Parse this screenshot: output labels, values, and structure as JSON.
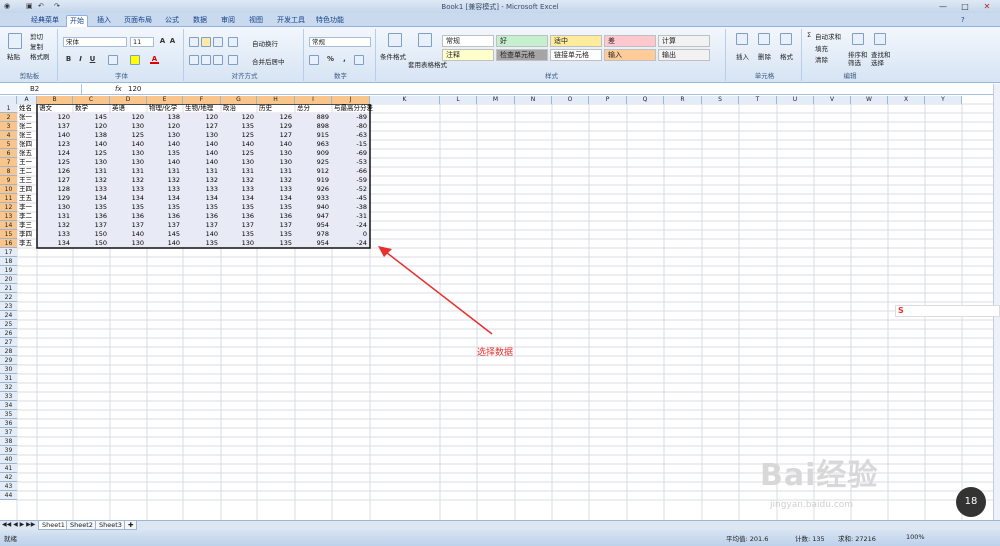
{
  "window": {
    "title": "Book1 [兼容模式] - Microsoft Excel",
    "min": "—",
    "max": "□",
    "close": "✕"
  },
  "tabs": [
    "经典菜单",
    "开始",
    "插入",
    "页面布局",
    "公式",
    "数据",
    "审阅",
    "视图",
    "开发工具",
    "特色功能"
  ],
  "ribbon": {
    "clipboard": {
      "title": "剪贴板",
      "paste": "粘贴",
      "cut": "剪切",
      "copy": "复制",
      "format_painter": "格式刷"
    },
    "font": {
      "title": "字体",
      "name": "宋体",
      "size": "11",
      "bold": "B",
      "italic": "I",
      "underline": "U"
    },
    "alignment": {
      "title": "对齐方式",
      "wrap": "自动换行",
      "merge": "合并后居中"
    },
    "number": {
      "title": "数字",
      "format": "常规",
      "percent": "%"
    },
    "styles": {
      "title": "样式",
      "conditional": "条件格式",
      "table": "套用表格格式",
      "cells": [
        {
          "label": "常规",
          "bg": "#ffffff"
        },
        {
          "label": "好",
          "bg": "#c6efce"
        },
        {
          "label": "适中",
          "bg": "#ffeb9c"
        },
        {
          "label": "差",
          "bg": "#ffc7ce"
        },
        {
          "label": "计算",
          "bg": "#f2f2f2"
        },
        {
          "label": "注释",
          "bg": "#ffffcc"
        },
        {
          "label": "检查单元格",
          "bg": "#a5a5a5"
        },
        {
          "label": "链接单元格",
          "bg": "#ffffff"
        },
        {
          "label": "输入",
          "bg": "#ffcc99"
        },
        {
          "label": "输出",
          "bg": "#f2f2f2"
        }
      ]
    },
    "cellsgroup": {
      "title": "单元格",
      "insert": "插入",
      "delete": "删除",
      "format": "格式"
    },
    "editing": {
      "title": "编辑",
      "autosum": "自动求和",
      "fill": "填充",
      "clear": "清除",
      "sort": "排序和筛选",
      "find": "查找和选择"
    }
  },
  "formula_bar": {
    "name_box": "B2",
    "fx": "fx",
    "value": "120"
  },
  "columns": [
    "A",
    "B",
    "C",
    "D",
    "E",
    "F",
    "G",
    "H",
    "I",
    "J",
    "K",
    "L",
    "M",
    "N",
    "O",
    "P",
    "Q",
    "R",
    "S",
    "T",
    "U",
    "V",
    "W",
    "X",
    "Y"
  ],
  "rows": [
    "1",
    "2",
    "3",
    "4",
    "5",
    "6",
    "7",
    "8",
    "9",
    "10",
    "11",
    "12",
    "13",
    "14",
    "15",
    "16",
    "17",
    "18",
    "19",
    "20",
    "21",
    "22",
    "23",
    "24",
    "25",
    "26",
    "27",
    "28",
    "29",
    "30",
    "31",
    "32",
    "33",
    "34",
    "35",
    "36",
    "37",
    "38",
    "39",
    "40",
    "41",
    "42",
    "43",
    "44"
  ],
  "headers": [
    "姓名",
    "语文",
    "数学",
    "英语",
    "物理/化学",
    "生物/地理",
    "政治",
    "历史",
    "总分",
    "与最高分分差"
  ],
  "table": [
    [
      "张一",
      "120",
      "145",
      "120",
      "138",
      "120",
      "120",
      "126",
      "889",
      "-89"
    ],
    [
      "张二",
      "137",
      "120",
      "130",
      "120",
      "127",
      "135",
      "129",
      "898",
      "-80"
    ],
    [
      "张三",
      "140",
      "138",
      "125",
      "130",
      "130",
      "125",
      "127",
      "915",
      "-63"
    ],
    [
      "张四",
      "123",
      "140",
      "140",
      "140",
      "140",
      "140",
      "140",
      "963",
      "-15"
    ],
    [
      "张五",
      "124",
      "125",
      "130",
      "135",
      "140",
      "125",
      "130",
      "909",
      "-69"
    ],
    [
      "王一",
      "125",
      "130",
      "130",
      "140",
      "140",
      "130",
      "130",
      "925",
      "-53"
    ],
    [
      "王二",
      "126",
      "131",
      "131",
      "131",
      "131",
      "131",
      "131",
      "912",
      "-66"
    ],
    [
      "王三",
      "127",
      "132",
      "132",
      "132",
      "132",
      "132",
      "132",
      "919",
      "-59"
    ],
    [
      "王四",
      "128",
      "133",
      "133",
      "133",
      "133",
      "133",
      "133",
      "926",
      "-52"
    ],
    [
      "王五",
      "129",
      "134",
      "134",
      "134",
      "134",
      "134",
      "134",
      "933",
      "-45"
    ],
    [
      "李一",
      "130",
      "135",
      "135",
      "135",
      "135",
      "135",
      "135",
      "940",
      "-38"
    ],
    [
      "李二",
      "131",
      "136",
      "136",
      "136",
      "136",
      "136",
      "136",
      "947",
      "-31"
    ],
    [
      "李三",
      "132",
      "137",
      "137",
      "137",
      "137",
      "137",
      "137",
      "954",
      "-24"
    ],
    [
      "李四",
      "133",
      "150",
      "140",
      "145",
      "140",
      "135",
      "135",
      "978",
      "0"
    ],
    [
      "李五",
      "134",
      "150",
      "130",
      "140",
      "135",
      "130",
      "135",
      "954",
      "-24"
    ]
  ],
  "annotation": "选择数据",
  "sheets": [
    "Sheet1",
    "Sheet2",
    "Sheet3"
  ],
  "status": {
    "ready": "就绪",
    "average": "平均值: 201.6",
    "count": "计数: 135",
    "sum": "求和: 27216",
    "zoom": "100%"
  },
  "badge": "18",
  "watermark": "Bai经验",
  "watermark_url": "jingyan.baidu.com"
}
